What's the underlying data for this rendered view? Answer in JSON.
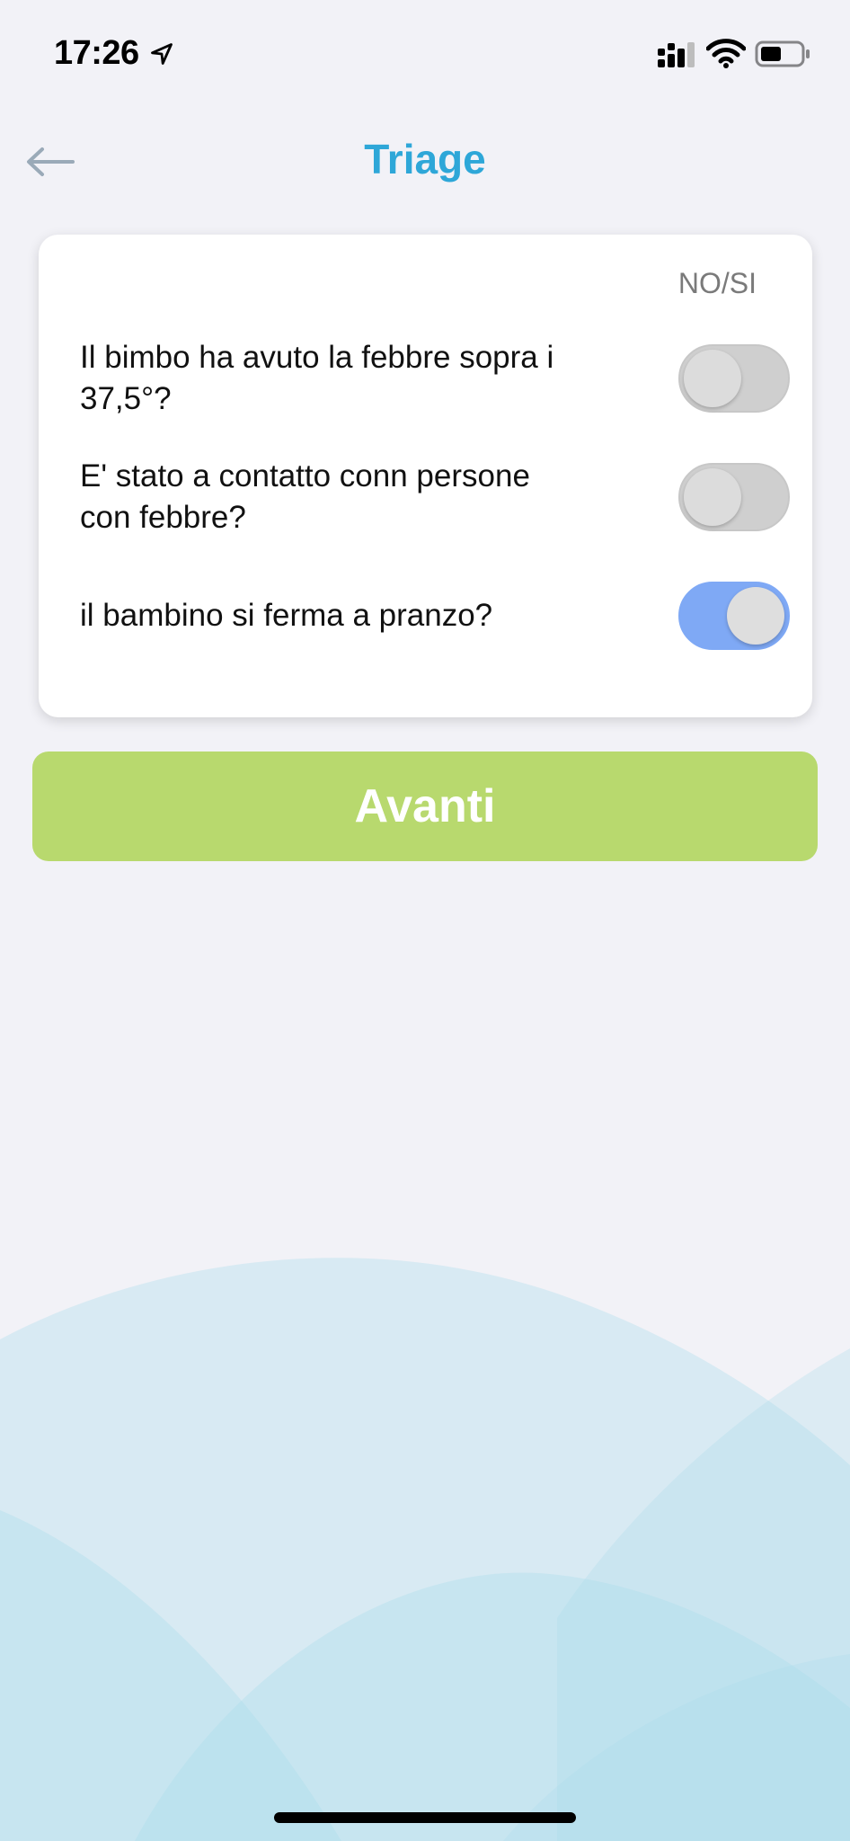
{
  "status_bar": {
    "time": "17:26",
    "icons": [
      "location-arrow-icon",
      "cellular-signal-icon",
      "wifi-icon",
      "battery-icon"
    ]
  },
  "nav": {
    "title": "Triage",
    "back_icon": "arrow-left-icon"
  },
  "card": {
    "column_header": "NO/SI",
    "questions": [
      {
        "label": "Il bimbo ha avuto la febbre sopra i 37,5°?",
        "value": false
      },
      {
        "label": "E' stato a contatto conn persone con febbre?",
        "value": false
      },
      {
        "label": "il bambino si ferma a pranzo?",
        "value": true
      }
    ]
  },
  "actions": {
    "next_label": "Avanti"
  },
  "colors": {
    "title": "#2ea7d8",
    "button": "#b8d96e",
    "toggle_on": "#7fa9f5",
    "toggle_off": "#cfcfcf",
    "background": "#f2f2f7",
    "wave": "#a9dcec"
  }
}
